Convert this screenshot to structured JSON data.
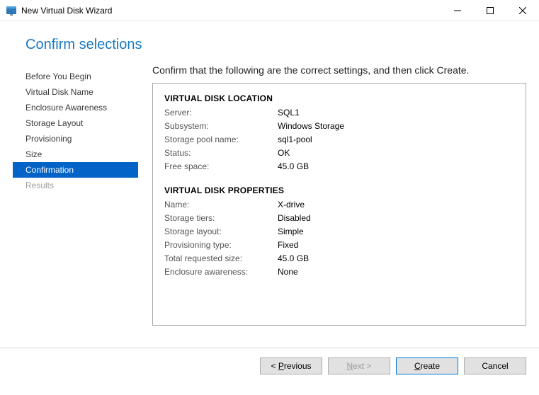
{
  "titlebar": {
    "title": "New Virtual Disk Wizard"
  },
  "header": {
    "title": "Confirm selections"
  },
  "sidebar": {
    "items": [
      {
        "label": "Before You Begin",
        "state": "normal"
      },
      {
        "label": "Virtual Disk Name",
        "state": "normal"
      },
      {
        "label": "Enclosure Awareness",
        "state": "normal"
      },
      {
        "label": "Storage Layout",
        "state": "normal"
      },
      {
        "label": "Provisioning",
        "state": "normal"
      },
      {
        "label": "Size",
        "state": "normal"
      },
      {
        "label": "Confirmation",
        "state": "selected"
      },
      {
        "label": "Results",
        "state": "disabled"
      }
    ]
  },
  "content": {
    "instruction": "Confirm that the following are the correct settings, and then click Create.",
    "sections": {
      "location": {
        "title": "VIRTUAL DISK LOCATION",
        "rows": [
          {
            "label": "Server:",
            "value": "SQL1"
          },
          {
            "label": "Subsystem:",
            "value": "Windows Storage"
          },
          {
            "label": "Storage pool name:",
            "value": "sql1-pool"
          },
          {
            "label": "Status:",
            "value": "OK"
          },
          {
            "label": "Free space:",
            "value": "45.0 GB"
          }
        ]
      },
      "properties": {
        "title": "VIRTUAL DISK PROPERTIES",
        "rows": [
          {
            "label": "Name:",
            "value": "X-drive"
          },
          {
            "label": "Storage tiers:",
            "value": "Disabled"
          },
          {
            "label": "Storage layout:",
            "value": "Simple"
          },
          {
            "label": "Provisioning type:",
            "value": "Fixed"
          },
          {
            "label": "Total requested size:",
            "value": "45.0 GB"
          },
          {
            "label": "Enclosure awareness:",
            "value": "None"
          }
        ]
      }
    }
  },
  "footer": {
    "previous": "< Previous",
    "next": "Next >",
    "create": "Create",
    "cancel": "Cancel"
  }
}
